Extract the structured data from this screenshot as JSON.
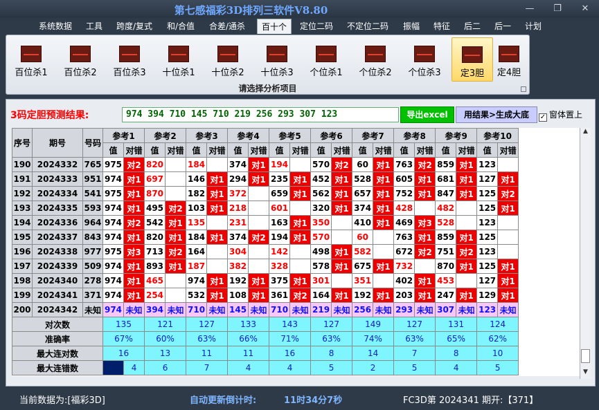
{
  "app": {
    "title": "第七感福彩3D排列三软件V8.80"
  },
  "menu": [
    "系统数据",
    "工具",
    "跨度/复式",
    "和/合值",
    "合差/通杀",
    "百十个",
    "定位二码",
    "不定位二码",
    "振幅",
    "特征",
    "后二",
    "后一",
    "计划"
  ],
  "ribbon": {
    "buttons": [
      "百位杀1",
      "百位杀2",
      "百位杀3",
      "十位杀1",
      "十位杀2",
      "十位杀3",
      "个位杀1",
      "个位杀2",
      "个位杀3",
      "定3胆",
      "定4胆"
    ],
    "group_label": "请选择分析项目"
  },
  "prediction": {
    "label": "3码定胆预测结果:",
    "value": "974 394 710 145 710 219 256 293 307 123",
    "export_label": "导出excel",
    "generate_label": "用结果>生成大底",
    "topmost_label": "窗体置上"
  },
  "table": {
    "headers": {
      "seq": "序号",
      "period": "期号",
      "code": "号码",
      "refs": [
        "参考1",
        "参考2",
        "参考3",
        "参考4",
        "参考5",
        "参考6",
        "参考7",
        "参考8",
        "参考9",
        "参考10"
      ],
      "sub": [
        "值",
        "对错"
      ]
    },
    "rows": [
      {
        "seq": "190",
        "period": "2024332",
        "code": "765",
        "cells": [
          [
            "975",
            "对2"
          ],
          [
            "820",
            ""
          ],
          [
            "184",
            ""
          ],
          [
            "374",
            "对1"
          ],
          [
            "194",
            ""
          ],
          [
            "570",
            "对2"
          ],
          [
            "60",
            "对1"
          ],
          [
            "763",
            "对2"
          ],
          [
            "859",
            "对1"
          ],
          [
            "123",
            ""
          ]
        ]
      },
      {
        "seq": "191",
        "period": "2024333",
        "code": "951",
        "cells": [
          [
            "974",
            "对1"
          ],
          [
            "697",
            ""
          ],
          [
            "146",
            "对1"
          ],
          [
            "294",
            "对1"
          ],
          [
            "235",
            "对1"
          ],
          [
            "452",
            "对1"
          ],
          [
            "528",
            "对1"
          ],
          [
            "605",
            "对1"
          ],
          [
            "681",
            "对1"
          ],
          [
            "127",
            "对1"
          ]
        ]
      },
      {
        "seq": "192",
        "period": "2024334",
        "code": "541",
        "cells": [
          [
            "975",
            "对1"
          ],
          [
            "870",
            ""
          ],
          [
            "182",
            "对1"
          ],
          [
            "372",
            ""
          ],
          [
            "659",
            "对1"
          ],
          [
            "562",
            "对1"
          ],
          [
            "657",
            "对1"
          ],
          [
            "752",
            "对1"
          ],
          [
            "847",
            "对1"
          ],
          [
            "125",
            "对2"
          ]
        ]
      },
      {
        "seq": "193",
        "period": "2024335",
        "code": "593",
        "cells": [
          [
            "974",
            "对1"
          ],
          [
            "495",
            "对2"
          ],
          [
            "103",
            "对1"
          ],
          [
            "218",
            ""
          ],
          [
            "601",
            ""
          ],
          [
            "320",
            "对1"
          ],
          [
            "374",
            "对1"
          ],
          [
            "428",
            ""
          ],
          [
            "482",
            ""
          ],
          [
            "125",
            "对1"
          ]
        ]
      },
      {
        "seq": "194",
        "period": "2024336",
        "code": "964",
        "cells": [
          [
            "974",
            "对2"
          ],
          [
            "542",
            "对1"
          ],
          [
            "135",
            ""
          ],
          [
            "231",
            ""
          ],
          [
            "163",
            "对1"
          ],
          [
            "350",
            ""
          ],
          [
            "410",
            "对1"
          ],
          [
            "469",
            "对3"
          ],
          [
            "528",
            ""
          ],
          [
            "123",
            ""
          ]
        ]
      },
      {
        "seq": "195",
        "period": "2024337",
        "code": "843",
        "cells": [
          [
            "974",
            "对1"
          ],
          [
            "820",
            "对1"
          ],
          [
            "184",
            "对1"
          ],
          [
            "374",
            "对2"
          ],
          [
            "194",
            "对1"
          ],
          [
            "570",
            ""
          ],
          [
            "60",
            ""
          ],
          [
            "763",
            "对1"
          ],
          [
            "859",
            "对1"
          ],
          [
            "125",
            ""
          ]
        ]
      },
      {
        "seq": "196",
        "period": "2024338",
        "code": "977",
        "cells": [
          [
            "975",
            "对3"
          ],
          [
            "713",
            "对2"
          ],
          [
            "164",
            ""
          ],
          [
            "304",
            ""
          ],
          [
            "142",
            ""
          ],
          [
            "498",
            "对1"
          ],
          [
            "582",
            ""
          ],
          [
            "672",
            "对2"
          ],
          [
            "751",
            "对2"
          ],
          [
            "123",
            ""
          ]
        ]
      },
      {
        "seq": "197",
        "period": "2024339",
        "code": "509",
        "cells": [
          [
            "974",
            "对1"
          ],
          [
            "893",
            "对1"
          ],
          [
            "187",
            ""
          ],
          [
            "382",
            ""
          ],
          [
            "328",
            ""
          ],
          [
            "578",
            "对1"
          ],
          [
            "675",
            "对1"
          ],
          [
            "732",
            ""
          ],
          [
            "870",
            "对1"
          ],
          [
            "125",
            "对1"
          ]
        ]
      },
      {
        "seq": "198",
        "period": "2024340",
        "code": "278",
        "cells": [
          [
            "974",
            "对1"
          ],
          [
            "465",
            ""
          ],
          [
            "974",
            "对1"
          ],
          [
            "192",
            "对1"
          ],
          [
            "375",
            "对1"
          ],
          [
            "301",
            ""
          ],
          [
            "351",
            ""
          ],
          [
            "402",
            "对1"
          ],
          [
            "453",
            ""
          ],
          [
            "127",
            "对1"
          ]
        ]
      },
      {
        "seq": "199",
        "period": "2024341",
        "code": "371",
        "cells": [
          [
            "974",
            "对1"
          ],
          [
            "254",
            ""
          ],
          [
            "532",
            "对1"
          ],
          [
            "108",
            "对1"
          ],
          [
            "361",
            "对2"
          ],
          [
            "164",
            "对1"
          ],
          [
            "192",
            "对1"
          ],
          [
            "203",
            "对1"
          ],
          [
            "247",
            "对1"
          ],
          [
            "129",
            "对1"
          ]
        ]
      }
    ],
    "red_text": [
      [
        "",
        "820",
        "184",
        "",
        "194",
        "",
        "",
        "",
        "",
        ""
      ],
      [
        "",
        "697",
        "",
        "",
        "",
        "",
        "",
        "",
        "",
        ""
      ],
      [
        "",
        "870",
        "",
        "372",
        "",
        "",
        "",
        "",
        "",
        ""
      ],
      [
        "",
        "",
        "",
        "218",
        "601",
        "",
        "",
        "428",
        "482",
        ""
      ],
      [
        "",
        "",
        "135",
        "231",
        "",
        "350",
        "",
        "",
        "528",
        ""
      ],
      [
        "",
        "",
        "",
        "",
        "",
        "570",
        "60",
        "",
        "",
        ""
      ],
      [
        "",
        "",
        "",
        "304",
        "142",
        "",
        "582",
        "",
        "",
        ""
      ],
      [
        "",
        "",
        "187",
        "382",
        "328",
        "",
        "",
        "732",
        "",
        ""
      ],
      [
        "",
        "465",
        "",
        "",
        "",
        "301",
        "351",
        "",
        "453",
        ""
      ],
      [
        "",
        "254",
        "",
        "",
        "",
        "",
        "",
        "",
        "",
        ""
      ]
    ],
    "pred_row": {
      "seq": "200",
      "period": "2024342",
      "code": "未知",
      "values": [
        "974",
        "394",
        "710",
        "145",
        "710",
        "219",
        "256",
        "293",
        "307",
        "123"
      ],
      "status": "未知"
    },
    "stats": [
      {
        "label": "对次数",
        "values": [
          "135",
          "121",
          "127",
          "133",
          "143",
          "127",
          "149",
          "127",
          "131",
          "124"
        ]
      },
      {
        "label": "准确率",
        "values": [
          "67%",
          "60%",
          "63%",
          "66%",
          "71%",
          "63%",
          "74%",
          "63%",
          "65%",
          "62%"
        ]
      },
      {
        "label": "最大连对数",
        "values": [
          "16",
          "13",
          "11",
          "11",
          "16",
          "8",
          "14",
          "7",
          "8",
          "10"
        ]
      },
      {
        "label": "最大连错数",
        "values": [
          "4",
          "6",
          "7",
          "4",
          "4",
          "5",
          "2",
          "5",
          "4",
          "5"
        ]
      }
    ]
  },
  "status": {
    "current_data": "当前数据为:[福彩3D]",
    "countdown_label": "自动更新倒计时:",
    "countdown_value": "11时34分7秒",
    "issue": "FC3D第 2024341 期开:【371】"
  },
  "colors": {
    "hit": "#ee0000",
    "stats": "#7ff5ff",
    "predict": "#f8c8f8",
    "title": "#6fa8ff"
  }
}
